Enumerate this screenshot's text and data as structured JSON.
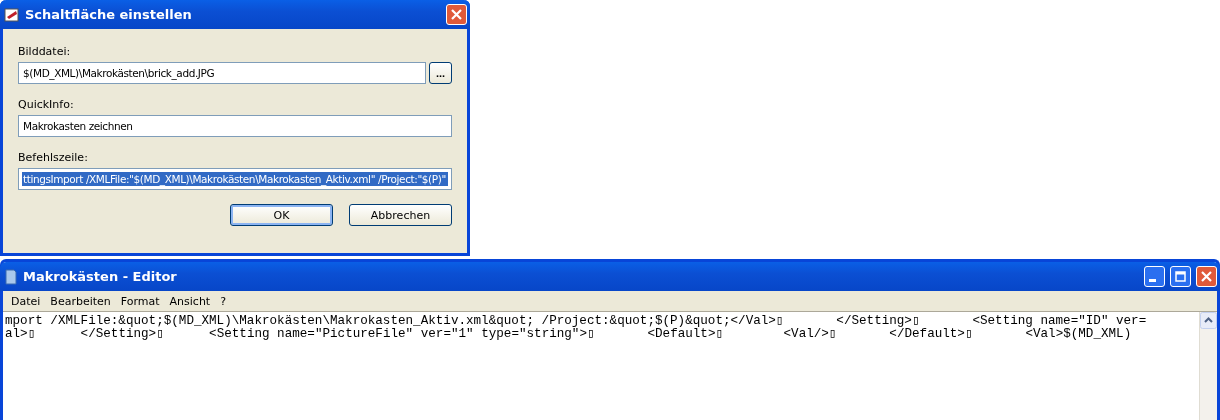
{
  "dialog": {
    "title": "Schaltfläche einstellen",
    "fields": [
      {
        "label": "Bilddatei:",
        "value": "$(MD_XML)\\Makrokästen\\brick_add.JPG",
        "browse": "...",
        "selected": false
      },
      {
        "label": "QuickInfo:",
        "value": "Makrokasten zeichnen",
        "selected": false
      },
      {
        "label": "Befehlszeile:",
        "value": "ttingsImport /XMLFile:\"$(MD_XML)\\Makrokästen\\Makrokasten_Aktiv.xml\" /Project:\"$(P)\"",
        "selected": true
      }
    ],
    "buttons": [
      {
        "label": "OK",
        "default": true
      },
      {
        "label": "Abbrechen",
        "default": false
      }
    ]
  },
  "editor": {
    "title": "Makrokästen - Editor",
    "menu": [
      "Datei",
      "Bearbeiten",
      "Format",
      "Ansicht",
      "?"
    ],
    "lines": [
      "mport /XMLFile:&quot;$(MD_XML)\\Makrokästen\\Makrokasten_Aktiv.xml&quot; /Project:&quot;$(P)&quot;</Val>▯       </Setting>▯       <Setting name=\"ID\" ver=",
      "al>▯      </Setting>▯      <Setting name=\"PictureFile\" ver=\"1\" type=\"string\">▯       <Default>▯        <Val/>▯       </Default>▯       <Val>$(MD_XML)"
    ]
  }
}
